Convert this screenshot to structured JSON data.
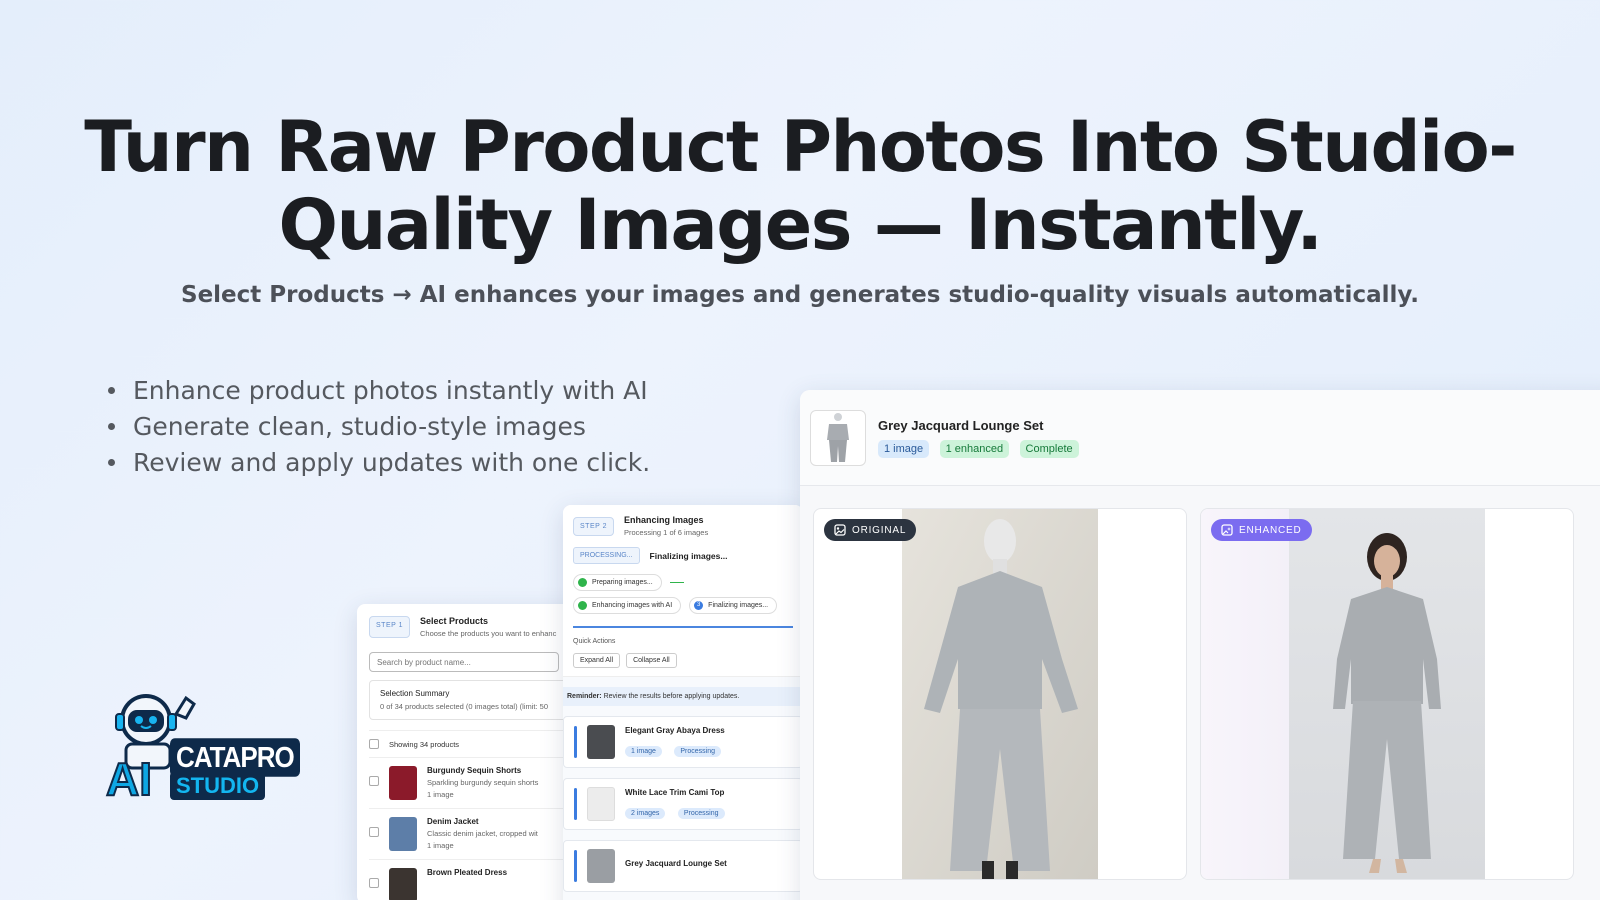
{
  "hero": {
    "title_line1": "Turn Raw Product Photos Into Studio-",
    "title_line2": "Quality Images — Instantly.",
    "subtitle": "Select Products → AI enhances your images and generates studio-quality visuals automatically."
  },
  "features": [
    "Enhance product photos instantly with AI",
    "Generate clean, studio-style images",
    "Review and apply updates with one click."
  ],
  "logo": {
    "line1": "CATAPRO",
    "ai": "AI",
    "line2": "STUDIO"
  },
  "select_card": {
    "step": "STEP 1",
    "title": "Select Products",
    "desc": "Choose the products you want to enhanc",
    "search_placeholder": "Search by product name...",
    "summary_title": "Selection Summary",
    "summary_text": "0 of 34 products selected (0 images total) (limit: 50",
    "showing": "Showing 34 products",
    "products": [
      {
        "name": "Burgundy Sequin Shorts",
        "desc": "Sparkling burgundy sequin shorts",
        "images": "1 image",
        "color": "#8b1a2a"
      },
      {
        "name": "Denim Jacket",
        "desc": "Classic denim jacket, cropped wit",
        "images": "1 image",
        "color": "#5d7ea8"
      },
      {
        "name": "Brown Pleated Dress",
        "desc": "",
        "images": "",
        "color": "#3b3430"
      }
    ]
  },
  "enhance_card": {
    "step": "STEP 2",
    "title": "Enhancing Images",
    "desc": "Processing 1 of 6 images",
    "processing_badge": "PROCESSING...",
    "status": "Finalizing images...",
    "stage1": "Preparing images...",
    "stage2": "Enhancing images with AI",
    "stage3": "Finalizing images...",
    "stage3_num": "3",
    "quick_actions": "Quick Actions",
    "expand_all": "Expand All",
    "collapse_all": "Collapse All",
    "reminder_bold": "Reminder:",
    "reminder_text": " Review the results before applying updates.",
    "items": [
      {
        "name": "Elegant Gray Abaya Dress",
        "count": "1 image",
        "status": "Processing",
        "color": "#4a4c50"
      },
      {
        "name": "White Lace Trim Cami Top",
        "count": "2 images",
        "status": "Processing",
        "color": "#e8e8e8"
      },
      {
        "name": "Grey Jacquard Lounge Set",
        "count": "",
        "status": "",
        "color": "#9a9ea3"
      }
    ]
  },
  "main_panel": {
    "title": "Grey Jacquard Lounge Set",
    "badge_images": "1 image",
    "badge_enhanced": "1 enhanced",
    "badge_status": "Complete",
    "original_label": "ORIGINAL",
    "enhanced_label": "ENHANCED"
  }
}
